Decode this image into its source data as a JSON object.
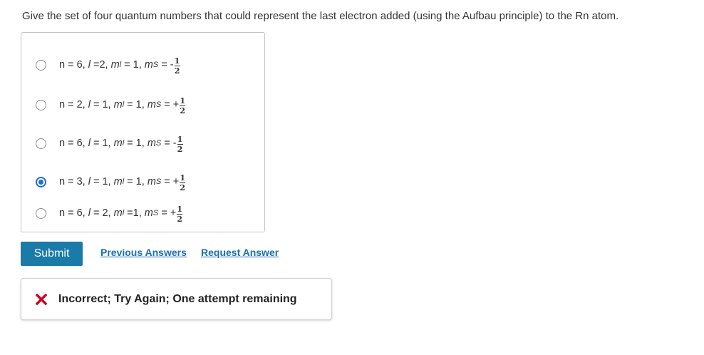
{
  "question": "Give the set of four quantum numbers that could represent the last electron added (using the Aufbau principle) to the Rn atom.",
  "options": [
    {
      "n_eq": "n = 6, ",
      "l": "l",
      "l_eq": " =2, ",
      "m": "m",
      "m_sub": "l",
      "m_eq": " = 1, ",
      "ms": "m",
      "ms_sub": "S",
      "ms_eq": " = -",
      "num": "1",
      "den": "2",
      "selected": false
    },
    {
      "n_eq": "n = 2, ",
      "l": "l",
      "l_eq": " = 1, ",
      "m": "m",
      "m_sub": "l",
      "m_eq": " = 1, ",
      "ms": "m",
      "ms_sub": "S",
      "ms_eq": " = +",
      "num": "1",
      "den": "2",
      "selected": false
    },
    {
      "n_eq": "n = 6, ",
      "l": "l",
      "l_eq": " = 1, ",
      "m": "m",
      "m_sub": "l",
      "m_eq": " = 1, ",
      "ms": "m",
      "ms_sub": "S",
      "ms_eq": " = -",
      "num": "1",
      "den": "2",
      "selected": false
    },
    {
      "n_eq": "n = 3, ",
      "l": "l",
      "l_eq": " = 1, ",
      "m": "m",
      "m_sub": "l",
      "m_eq": " = 1, ",
      "ms": "m",
      "ms_sub": "S",
      "ms_eq": " = +",
      "num": "1",
      "den": "2",
      "selected": true
    },
    {
      "n_eq": "n = 6, ",
      "l": "l",
      "l_eq": " = 2, ",
      "m": "m",
      "m_sub": "l",
      "m_eq": " =1, ",
      "ms": "m",
      "ms_sub": "S",
      "ms_eq": " = +",
      "num": "1",
      "den": "2",
      "selected": false
    }
  ],
  "actions": {
    "submit_label": "Submit",
    "previous_answers_label": "Previous Answers",
    "request_answer_label": "Request Answer"
  },
  "feedback": {
    "icon": "x-icon",
    "message": "Incorrect; Try Again; One attempt remaining",
    "color": "#d0021b"
  },
  "colors": {
    "submit_bg": "#1a7aa8",
    "link": "#1a6fb3",
    "radio_selected": "#1f6fd6"
  }
}
